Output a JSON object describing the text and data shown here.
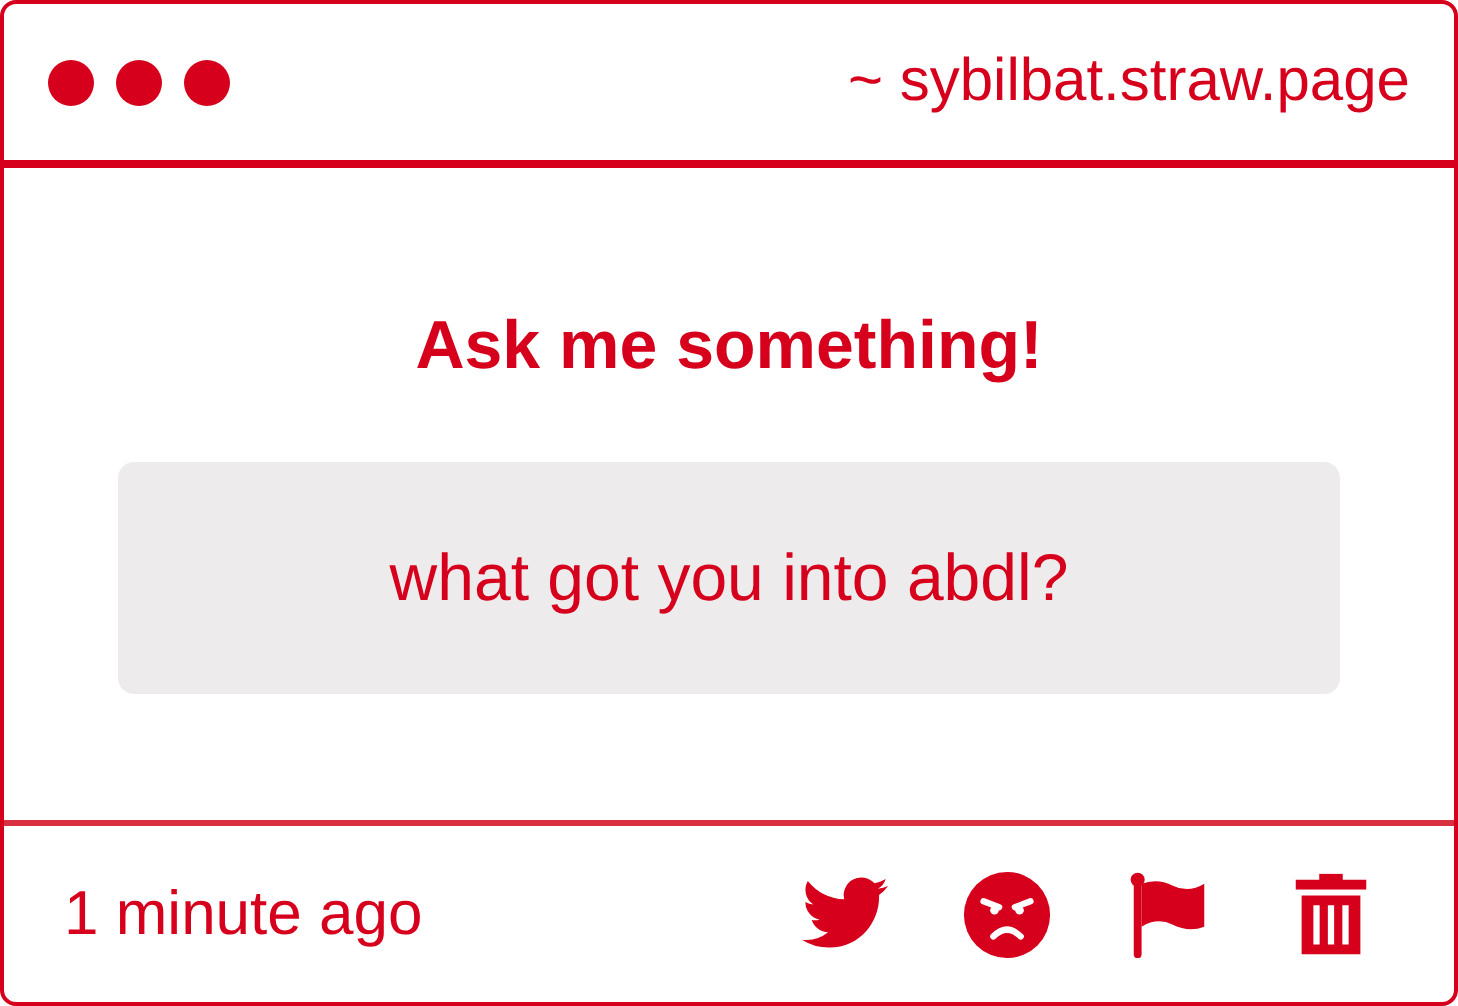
{
  "header": {
    "address": "~ sybilbat.straw.page"
  },
  "prompt": "Ask me something!",
  "question": "what got you into abdl?",
  "footer": {
    "timestamp": "1 minute ago",
    "actions": [
      {
        "kind": "twitter"
      },
      {
        "kind": "angry"
      },
      {
        "kind": "flag"
      },
      {
        "kind": "trash"
      }
    ]
  }
}
